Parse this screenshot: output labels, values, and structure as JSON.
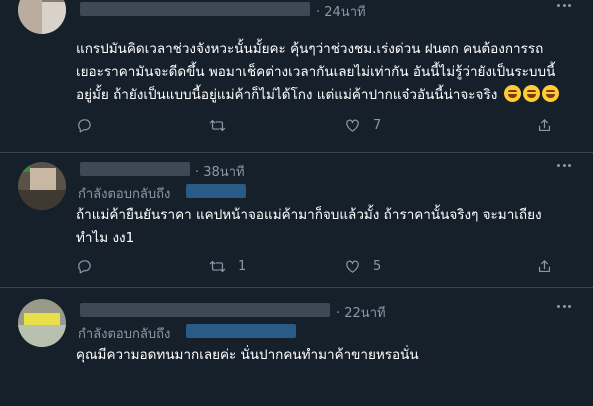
{
  "tweets": [
    {
      "time": "· 24นาที",
      "replying_label": "",
      "text": "แกรปมันคิดเวลาช่วงจังหวะนั้นมั้ยคะ คุ้นๆว่าช่วงชม.เร่งด่วน ฝนตก คนต้องการรถ\nเยอะราคามันจะดีดขึ้น พอมาเช็คต่างเวลากันเลยไม่เท่ากัน อันนี้ไม่รู้ว่ายังเป็นระบบนี้\nอยู่มั้ย ถ้ายังเป็นแบบนี้อยู่แม่ค้าก็ไม่ได้โกง แต่แม่ค้าปากแจ๋วอันนี้น่าจะจริง",
      "emoji": [
        "tears-of-joy-emoji",
        "tears-of-joy-emoji",
        "tears-of-joy-emoji"
      ],
      "counts": {
        "reply": "",
        "retweet": "",
        "like": "7"
      }
    },
    {
      "time": "· 38นาที",
      "replying_label": "กำลังตอบกลับถึง",
      "text": "ถ้าแม่ค้ายืนยันราคา แคปหน้าจอแม่ค้ามาก็จบแล้วมั้ง ถ้าราคานั้นจริงๆ จะมาเถียง\nทำไม งง1",
      "counts": {
        "reply": "",
        "retweet": "1",
        "like": "5"
      }
    },
    {
      "time": "· 22นาที",
      "replying_label": "กำลังตอบกลับถึง",
      "text": "คุณมีความอดทนมากเลยค่ะ นั่นปากคนทำมาค้าขายหรอนั่น",
      "counts": {
        "reply": "",
        "retweet": "",
        "like": ""
      }
    }
  ],
  "colors": {
    "background": "#15202b",
    "text": "#ffffff",
    "muted": "#8899a6",
    "divider": "#38444d",
    "mention": "#1d9bf0"
  },
  "icons": {
    "reply": "reply-icon",
    "retweet": "retweet-icon",
    "like": "like-icon",
    "share": "share-icon",
    "more": "more-icon"
  }
}
